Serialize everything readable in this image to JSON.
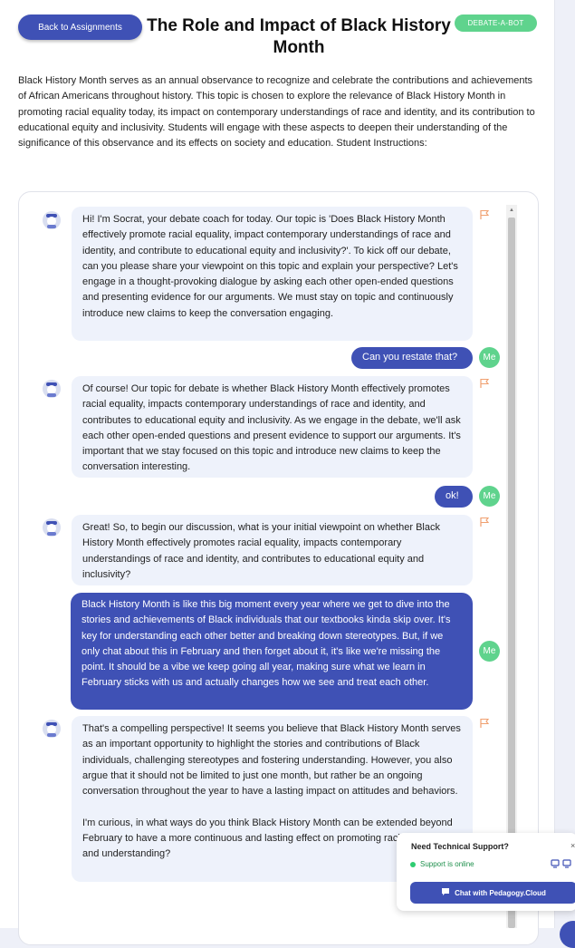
{
  "header": {
    "back_label": "Back to Assignments",
    "title": "The Role and Impact of Black History Month",
    "badge": "DEBATE-A-BOT"
  },
  "description": "Black History Month serves as an annual observance to recognize and celebrate the contributions and achievements of African Americans throughout history. This topic is chosen to explore the relevance of Black History Month in promoting racial equality today, its impact on contemporary understandings of race and identity, and its contribution to educational equity and inclusivity. Students will engage with these aspects to deepen their understanding of the significance of this observance and its effects on society and education. Student Instructions:",
  "chat": {
    "me_label": "Me",
    "messages": [
      {
        "role": "bot",
        "text": "Hi! I'm Socrat, your debate coach for today. Our topic is 'Does Black History Month effectively promote racial equality, impact contemporary understandings of race and identity, and contribute to educational equity and inclusivity?'. To kick off our debate, can you please share your viewpoint on this topic and explain your perspective? Let's engage in a thought-provoking dialogue by asking each other open-ended questions and presenting evidence for our arguments. We must stay on topic and continuously introduce new claims to keep the conversation engaging."
      },
      {
        "role": "user",
        "text": "Can you restate that?"
      },
      {
        "role": "bot",
        "text": "Of course! Our topic for debate is whether Black History Month effectively promotes racial equality, impacts contemporary understandings of race and identity, and contributes to educational equity and inclusivity. As we engage in the debate, we'll ask each other open-ended questions and present evidence to support our arguments. It's important that we stay focused on this topic and introduce new claims to keep the conversation interesting."
      },
      {
        "role": "user",
        "text": "ok!"
      },
      {
        "role": "bot",
        "text": "Great! So, to begin our discussion, what is your initial viewpoint on whether Black History Month effectively promotes racial equality, impacts contemporary understandings of race and identity, and contributes to educational equity and inclusivity?"
      },
      {
        "role": "user",
        "text": "Black History Month is like this big moment every year where we get to dive into the stories and achievements of Black individuals that our textbooks kinda skip over. It's key for understanding each other better and breaking down stereotypes. But, if we only chat about this in February and then forget about it, it's like we're missing the point. It should be a vibe we keep going all year, making sure what we learn in February sticks with us and actually changes how we see and treat each other."
      },
      {
        "role": "bot",
        "text": "That's a compelling perspective! It seems you believe that Black History Month serves as an important opportunity to highlight the stories and contributions of Black individuals, challenging stereotypes and fostering understanding. However, you also argue that it should not be limited to just one month, but rather be an ongoing conversation throughout the year to have a lasting impact on attitudes and behaviors.\n\nI'm curious, in what ways do you think Black History Month can be extended beyond February to have a more continuous and lasting effect on promoting racial equality and understanding?"
      }
    ]
  },
  "support": {
    "title": "Need Technical Support?",
    "status": "Support is online",
    "button": "Chat with Pedagogy.Cloud"
  },
  "colors": {
    "primary": "#3f51b5",
    "green": "#5fd38d",
    "bot_bubble": "#eef2fb"
  }
}
